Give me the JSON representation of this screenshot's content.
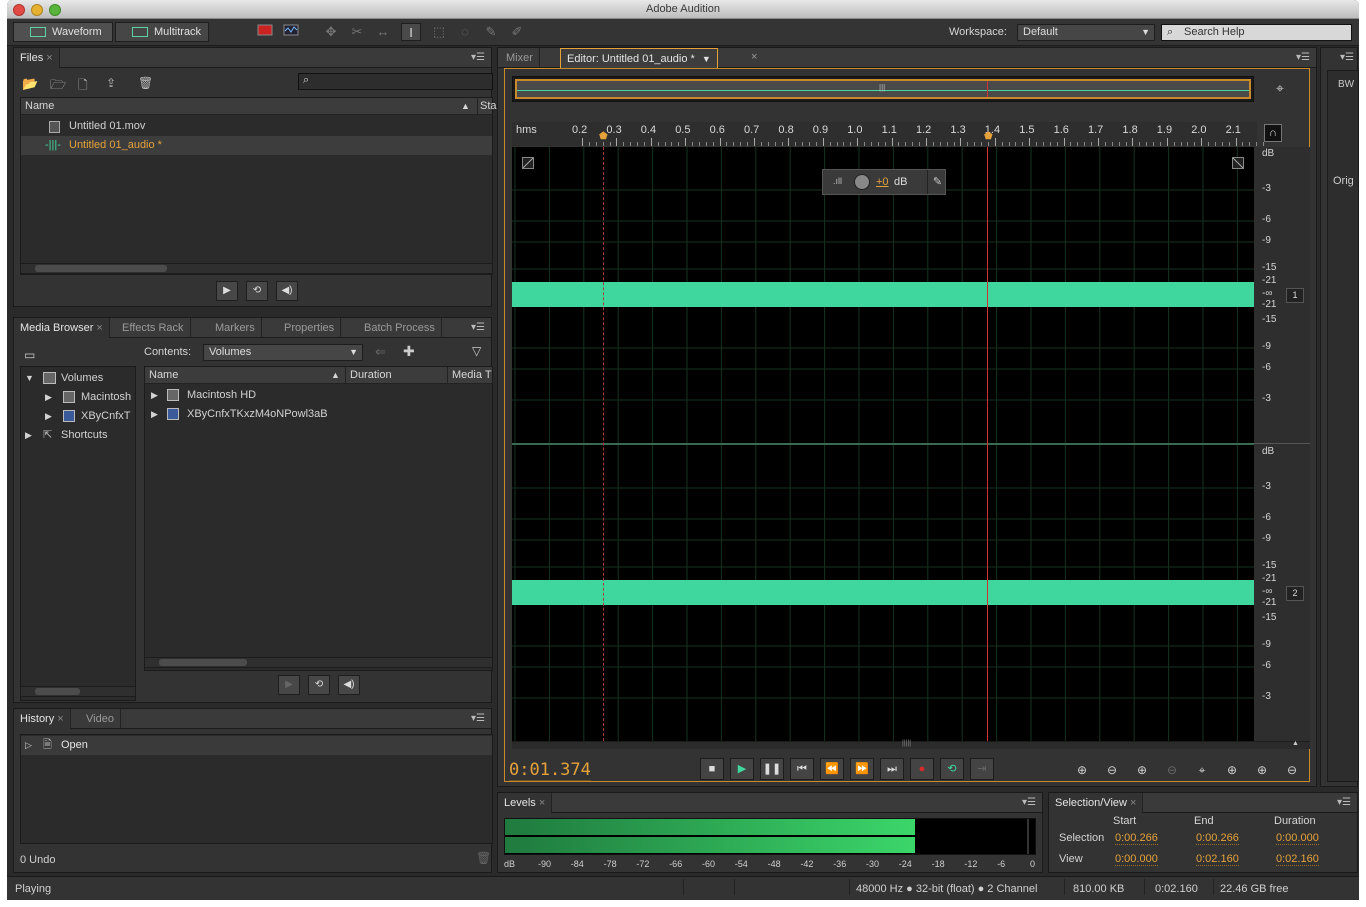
{
  "app": {
    "title": "Adobe Audition"
  },
  "toolbar": {
    "waveform": "Waveform",
    "multitrack": "Multitrack",
    "workspace_label": "Workspace:",
    "workspace_value": "Default",
    "search_placeholder": "Search Help"
  },
  "files": {
    "tab": "Files",
    "col_name": "Name",
    "col_status": "Sta",
    "items": [
      "Untitled 01.mov",
      "Untitled 01_audio *"
    ]
  },
  "media": {
    "tabs": [
      "Media Browser",
      "Effects Rack",
      "Markers",
      "Properties",
      "Batch Process"
    ],
    "contents_label": "Contents:",
    "contents_value": "Volumes",
    "tree": [
      "Volumes",
      "Macintosh",
      "XByCnfxT",
      "Shortcuts"
    ],
    "col_name": "Name",
    "col_duration": "Duration",
    "col_media": "Media T",
    "rows": [
      "Macintosh HD",
      "XByCnfxTKxzM4oNPowl3aB"
    ]
  },
  "history": {
    "tabs": [
      "History",
      "Video"
    ],
    "item": "Open",
    "undo": "0 Undo"
  },
  "editor": {
    "tab_mixer": "Mixer",
    "tab_editor": "Editor: Untitled 01_audio *",
    "ruler_unit": "hms",
    "ruler_ticks": [
      "0.2",
      "0.3",
      "0.4",
      "0.5",
      "0.6",
      "0.7",
      "0.8",
      "0.9",
      "1.0",
      "1.1",
      "1.2",
      "1.3",
      "1.4",
      "1.5",
      "1.6",
      "1.7",
      "1.8",
      "1.9",
      "2.0",
      "2.1"
    ],
    "db_header": "dB",
    "db_labels": [
      "-3",
      "-6",
      "-9",
      "-15",
      "-21",
      "-∞",
      "-21",
      "-15",
      "-9",
      "-6",
      "-3"
    ],
    "channel1": "1",
    "channel2": "2",
    "hud_value": "+0",
    "hud_unit": "dB",
    "time": "0:01.374",
    "side_top": "BW",
    "side_mid": "Orig"
  },
  "levels": {
    "tab": "Levels",
    "scale": [
      "dB",
      "-90",
      "-84",
      "-78",
      "-72",
      "-66",
      "-60",
      "-54",
      "-48",
      "-42",
      "-36",
      "-30",
      "-24",
      "-18",
      "-12",
      "-6",
      "0"
    ],
    "level_fraction": 0.77
  },
  "selection_view": {
    "tab": "Selection/View",
    "col_start": "Start",
    "col_end": "End",
    "col_duration": "Duration",
    "row_selection": "Selection",
    "row_view": "View",
    "sel_start": "0:00.266",
    "sel_end": "0:00.266",
    "sel_duration": "0:00.000",
    "view_start": "0:00.000",
    "view_end": "0:02.160",
    "view_duration": "0:02.160"
  },
  "status": {
    "state": "Playing",
    "format": "48000 Hz ● 32-bit (float) ● 2 Channel",
    "size": "810.00 KB",
    "duration": "0:02.160",
    "free": "22.46 GB free"
  },
  "colors": {
    "waveform": "#3fd79e",
    "accent": "#e5a23a",
    "playhead": "#d23232"
  }
}
